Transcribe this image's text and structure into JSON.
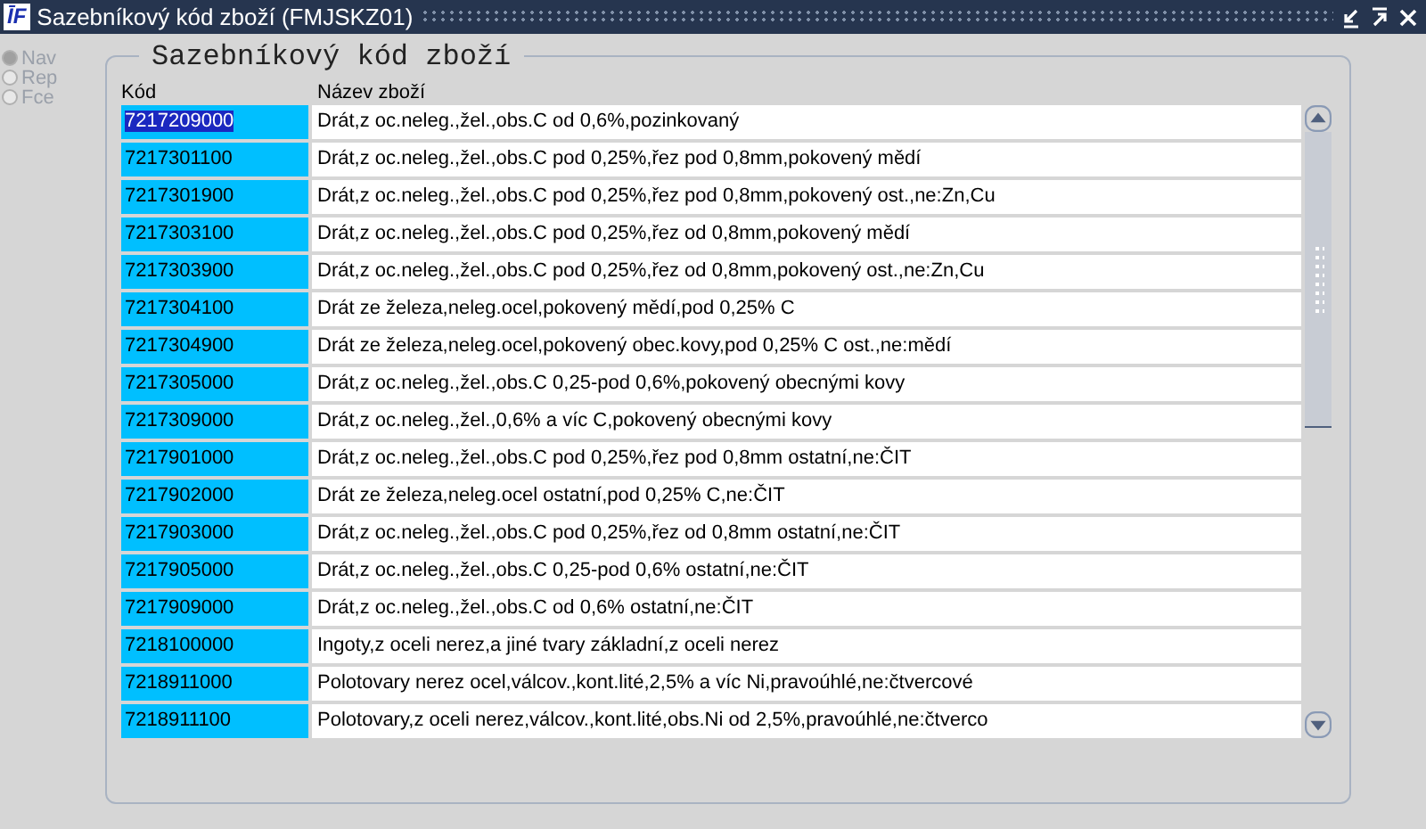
{
  "window": {
    "title": "Sazebníkový kód zboží (FMJSKZ01)",
    "logo": "ĪF"
  },
  "modes": [
    {
      "label": "Nav",
      "selected": true,
      "disabled": true
    },
    {
      "label": "Rep",
      "selected": false,
      "disabled": true
    },
    {
      "label": "Fce",
      "selected": false,
      "disabled": true
    }
  ],
  "frame": {
    "title": "Sazebníkový kód zboží"
  },
  "table": {
    "columns": [
      "Kód",
      "Název zboží"
    ],
    "rows": [
      {
        "code": "7217209000",
        "name": "Drát,z oc.neleg.,žel.,obs.C od 0,6%,pozinkovaný",
        "selected": true
      },
      {
        "code": "7217301100",
        "name": "Drát,z oc.neleg.,žel.,obs.C pod 0,25%,řez pod 0,8mm,pokovený mědí",
        "selected": false
      },
      {
        "code": "7217301900",
        "name": "Drát,z oc.neleg.,žel.,obs.C pod 0,25%,řez pod 0,8mm,pokovený ost.,ne:Zn,Cu",
        "selected": false
      },
      {
        "code": "7217303100",
        "name": "Drát,z oc.neleg.,žel.,obs.C pod 0,25%,řez od 0,8mm,pokovený mědí",
        "selected": false
      },
      {
        "code": "7217303900",
        "name": "Drát,z oc.neleg.,žel.,obs.C pod 0,25%,řez od 0,8mm,pokovený ost.,ne:Zn,Cu",
        "selected": false
      },
      {
        "code": "7217304100",
        "name": "Drát ze železa,neleg.ocel,pokovený mědí,pod 0,25% C",
        "selected": false
      },
      {
        "code": "7217304900",
        "name": "Drát ze železa,neleg.ocel,pokovený obec.kovy,pod 0,25% C ost.,ne:mědí",
        "selected": false
      },
      {
        "code": "7217305000",
        "name": "Drát,z oc.neleg.,žel.,obs.C 0,25-pod 0,6%,pokovený obecnými kovy",
        "selected": false
      },
      {
        "code": "7217309000",
        "name": "Drát,z oc.neleg.,žel.,0,6% a víc C,pokovený obecnými kovy",
        "selected": false
      },
      {
        "code": "7217901000",
        "name": "Drát,z oc.neleg.,žel.,obs.C pod 0,25%,řez pod 0,8mm ostatní,ne:ČIT",
        "selected": false
      },
      {
        "code": "7217902000",
        "name": "Drát ze železa,neleg.ocel ostatní,pod 0,25% C,ne:ČIT",
        "selected": false
      },
      {
        "code": "7217903000",
        "name": "Drát,z oc.neleg.,žel.,obs.C pod 0,25%,řez od 0,8mm ostatní,ne:ČIT",
        "selected": false
      },
      {
        "code": "7217905000",
        "name": "Drát,z oc.neleg.,žel.,obs.C 0,25-pod 0,6% ostatní,ne:ČIT",
        "selected": false
      },
      {
        "code": "7217909000",
        "name": "Drát,z oc.neleg.,žel.,obs.C od 0,6% ostatní,ne:ČIT",
        "selected": false
      },
      {
        "code": "7218100000",
        "name": "Ingoty,z oceli nerez,a jiné tvary základní,z oceli nerez",
        "selected": false
      },
      {
        "code": "7218911000",
        "name": "Polotovary nerez ocel,válcov.,kont.lité,2,5% a víc Ni,pravoúhlé,ne:čtvercové",
        "selected": false
      },
      {
        "code": "7218911100",
        "name": "Polotovary,z oceli nerez,válcov.,kont.lité,obs.Ni od 2,5%,pravoúhlé,ne:čtverco",
        "selected": false
      }
    ]
  }
}
